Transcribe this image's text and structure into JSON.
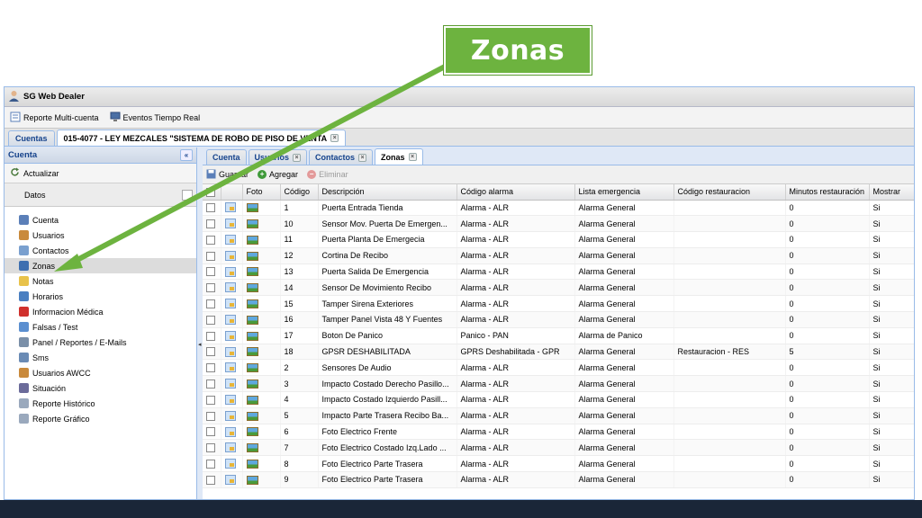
{
  "callout": {
    "label": "Zonas"
  },
  "app": {
    "title": "SG Web Dealer"
  },
  "toolbar": {
    "items": [
      {
        "label": "Reporte Multi-cuenta",
        "icon": "report-icon"
      },
      {
        "label": "Eventos Tiempo Real",
        "icon": "monitor-icon"
      }
    ]
  },
  "main_tabs": [
    {
      "label": "Cuentas"
    },
    {
      "label": "015-4077 - LEY MEZCALES \"SISTEMA DE ROBO DE PISO DE VENTA"
    }
  ],
  "left_panel": {
    "title": "Cuenta",
    "collapse": "«",
    "refresh_label": "Actualizar",
    "section_label": "Datos",
    "items": [
      {
        "label": "Cuenta",
        "icon": "card-icon",
        "color": "#5b7fb8"
      },
      {
        "label": "Usuarios",
        "icon": "users-icon",
        "color": "#c98a3c"
      },
      {
        "label": "Contactos",
        "icon": "contacts-icon",
        "color": "#7aa0cf"
      },
      {
        "label": "Zonas",
        "icon": "zones-icon",
        "color": "#3e6fb0"
      },
      {
        "label": "Notas",
        "icon": "notes-icon",
        "color": "#e8c24a"
      },
      {
        "label": "Horarios",
        "icon": "clock-icon",
        "color": "#4a7fc1"
      },
      {
        "label": "Informacion Médica",
        "icon": "medical-icon",
        "color": "#d0312d"
      },
      {
        "label": "Falsas / Test",
        "icon": "wrench-icon",
        "color": "#5b8fd0"
      },
      {
        "label": "Panel / Reportes / E-Mails",
        "icon": "panel-icon",
        "color": "#7a8fa8"
      },
      {
        "label": "Sms",
        "icon": "phone-icon",
        "color": "#6a8bb5"
      },
      {
        "label": "Usuarios AWCC",
        "icon": "awcc-users-icon",
        "color": "#c98a3c"
      },
      {
        "label": "Situación",
        "icon": "situation-icon",
        "color": "#6b6b9a"
      },
      {
        "label": "Reporte Histórico",
        "icon": "history-report-icon",
        "color": "#9aa9bd"
      },
      {
        "label": "Reporte Gráfico",
        "icon": "chart-report-icon",
        "color": "#9aa9bd"
      }
    ]
  },
  "sub_tabs": [
    {
      "label": "Cuenta"
    },
    {
      "label": "Usuarios"
    },
    {
      "label": "Contactos"
    },
    {
      "label": "Zonas"
    }
  ],
  "grid_toolbar": {
    "save": "Guardar",
    "add": "Agregar",
    "delete": "Eliminar"
  },
  "table": {
    "columns": [
      "",
      "",
      "Foto",
      "Código",
      "Descripción",
      "Código alarma",
      "Lista emergencia",
      "Código restauracion",
      "Minutos restauración",
      "Mostrar"
    ],
    "rows": [
      [
        "1",
        "Puerta Entrada Tienda",
        "Alarma - ALR",
        "Alarma General",
        "",
        "0",
        "Si"
      ],
      [
        "10",
        "Sensor Mov. Puerta De Emergen...",
        "Alarma - ALR",
        "Alarma General",
        "",
        "0",
        "Si"
      ],
      [
        "11",
        "Puerta Planta De Emergecia",
        "Alarma - ALR",
        "Alarma General",
        "",
        "0",
        "Si"
      ],
      [
        "12",
        "Cortina De Recibo",
        "Alarma - ALR",
        "Alarma General",
        "",
        "0",
        "Si"
      ],
      [
        "13",
        "Puerta Salida De Emergencia",
        "Alarma - ALR",
        "Alarma General",
        "",
        "0",
        "Si"
      ],
      [
        "14",
        "Sensor De Movimiento Recibo",
        "Alarma - ALR",
        "Alarma General",
        "",
        "0",
        "Si"
      ],
      [
        "15",
        "Tamper Sirena Exteriores",
        "Alarma - ALR",
        "Alarma General",
        "",
        "0",
        "Si"
      ],
      [
        "16",
        "Tamper Panel Vista 48 Y Fuentes",
        "Alarma - ALR",
        "Alarma General",
        "",
        "0",
        "Si"
      ],
      [
        "17",
        "Boton De Panico",
        "Panico - PAN",
        "Alarma de Panico",
        "",
        "0",
        "Si"
      ],
      [
        "18",
        "GPSR DESHABILITADA",
        "GPRS Deshabilitada - GPR",
        "Alarma General",
        "Restauracion - RES",
        "5",
        "Si"
      ],
      [
        "2",
        "Sensores De Audio",
        "Alarma - ALR",
        "Alarma General",
        "",
        "0",
        "Si"
      ],
      [
        "3",
        "Impacto Costado Derecho Pasillo...",
        "Alarma - ALR",
        "Alarma General",
        "",
        "0",
        "Si"
      ],
      [
        "4",
        "Impacto Costado Izquierdo Pasill...",
        "Alarma - ALR",
        "Alarma General",
        "",
        "0",
        "Si"
      ],
      [
        "5",
        "Impacto Parte Trasera Recibo Ba...",
        "Alarma - ALR",
        "Alarma General",
        "",
        "0",
        "Si"
      ],
      [
        "6",
        "Foto Electrico Frente",
        "Alarma - ALR",
        "Alarma General",
        "",
        "0",
        "Si"
      ],
      [
        "7",
        "Foto Electrico Costado Izq.Lado ...",
        "Alarma - ALR",
        "Alarma General",
        "",
        "0",
        "Si"
      ],
      [
        "8",
        "Foto Electrico Parte Trasera",
        "Alarma - ALR",
        "Alarma General",
        "",
        "0",
        "Si"
      ],
      [
        "9",
        "Foto Electrico Parte Trasera",
        "Alarma - ALR",
        "Alarma General",
        "",
        "0",
        "Si"
      ]
    ]
  }
}
